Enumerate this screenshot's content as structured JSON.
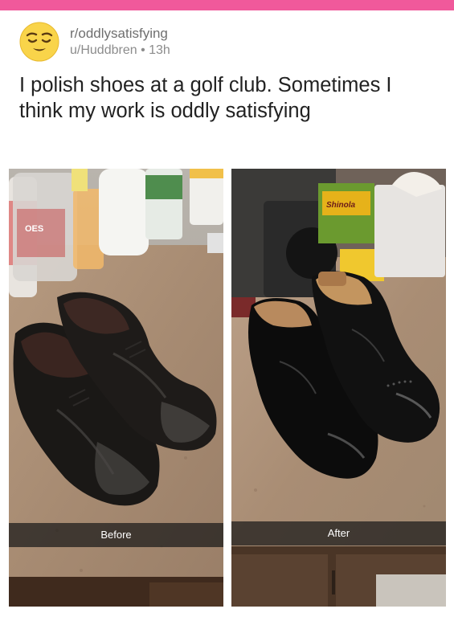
{
  "post": {
    "subreddit": "r/oddlysatisfying",
    "user": "u/Huddbren",
    "time": "13h",
    "title": "I polish shoes at a golf club. Sometimes I think my work is oddly satisfying"
  },
  "images": {
    "before_caption": "Before",
    "after_caption": "After",
    "after_product_label": "Shinola"
  },
  "colors": {
    "accent_bar": "#f0599b",
    "avatar_face": "#f9d44a"
  }
}
